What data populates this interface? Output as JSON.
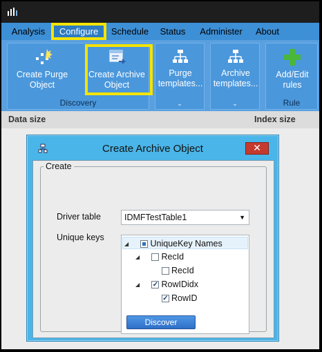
{
  "menu": {
    "items": [
      {
        "label": "Analysis"
      },
      {
        "label": "Configure"
      },
      {
        "label": "Schedule"
      },
      {
        "label": "Status"
      },
      {
        "label": "Administer"
      },
      {
        "label": "About"
      }
    ],
    "active": "Configure"
  },
  "ribbon": {
    "discovery_group": "Discovery",
    "rule_group": "Rule",
    "create_purge": "Create Purge Object",
    "create_archive": "Create Archive Object",
    "purge_templates": "Purge templates...",
    "archive_templates": "Archive templates...",
    "add_edit_rules": "Add/Edit rules"
  },
  "columns": {
    "data_size": "Data size",
    "index_size": "Index size"
  },
  "dialog": {
    "title": "Create Archive Object",
    "close_glyph": "✕",
    "group_label": "Create",
    "driver_table_label": "Driver table",
    "driver_table_value": "IDMFTestTable1",
    "unique_keys_label": "Unique keys",
    "tree": {
      "root": "UniqueKey Names",
      "k1": "RecId",
      "k1_child": "RecId",
      "k2": "RowIDidx",
      "k2_child": "RowID"
    },
    "discover_button": "Discover"
  },
  "colors": {
    "menu_bg": "#3d8fd6",
    "ribbon_bg": "#5aa0e0",
    "highlight": "#f5e400",
    "dialog_frame": "#4ab5e8",
    "close_button": "#c43b2e"
  },
  "icons": {
    "app": "app-logo-icon",
    "create_purge": "purge-object-icon",
    "create_archive": "archive-object-icon",
    "purge_templates": "purge-templates-icon",
    "archive_templates": "archive-templates-icon",
    "add_edit_rules": "add-rule-plus-icon"
  }
}
